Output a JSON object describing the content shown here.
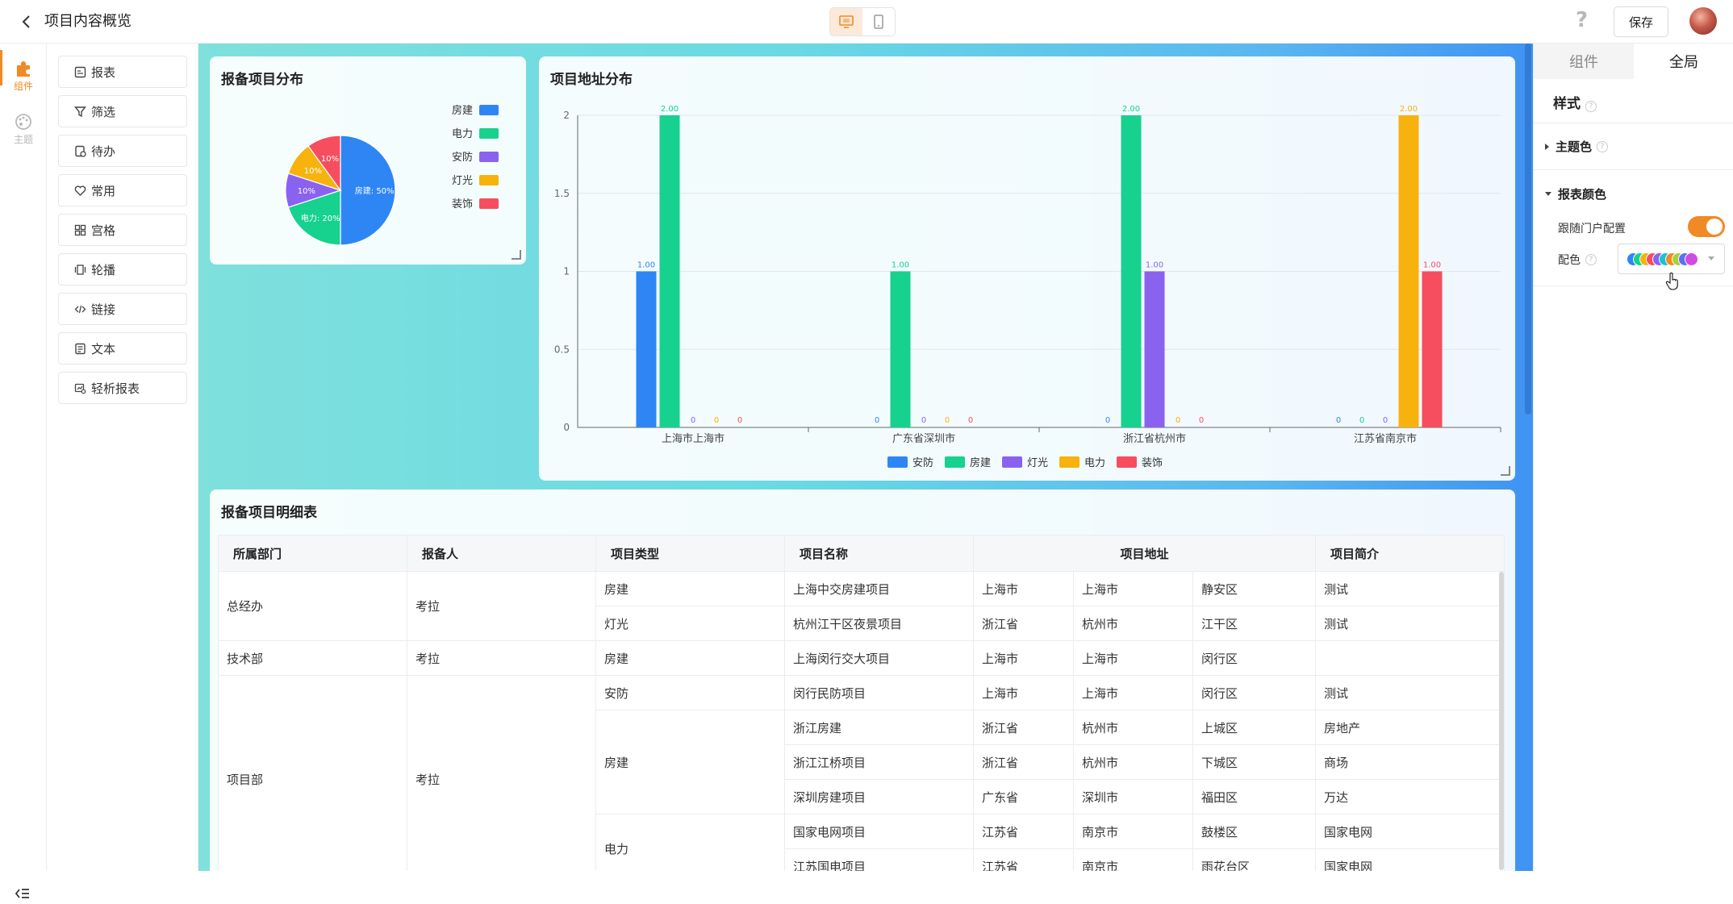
{
  "header": {
    "title": "项目内容概览",
    "save_label": "保存",
    "help_label": "?"
  },
  "rail": {
    "items": [
      {
        "label": "组件",
        "icon": "puzzle-icon",
        "active": true
      },
      {
        "label": "主题",
        "icon": "palette-icon",
        "active": false
      }
    ]
  },
  "components": {
    "items": [
      {
        "label": "报表",
        "icon": "report-icon"
      },
      {
        "label": "筛选",
        "icon": "filter-icon"
      },
      {
        "label": "待办",
        "icon": "todo-icon"
      },
      {
        "label": "常用",
        "icon": "heart-icon"
      },
      {
        "label": "宫格",
        "icon": "grid-icon"
      },
      {
        "label": "轮播",
        "icon": "carousel-icon"
      },
      {
        "label": "链接",
        "icon": "code-link-icon"
      },
      {
        "label": "文本",
        "icon": "text-icon"
      },
      {
        "label": "轻析报表",
        "icon": "analysis-report-icon"
      }
    ]
  },
  "pie_card": {
    "title": "报备项目分布"
  },
  "bar_card": {
    "title": "项目地址分布"
  },
  "chart_data": [
    {
      "type": "pie",
      "title": "报备项目分布",
      "categories": [
        "房建",
        "电力",
        "安防",
        "灯光",
        "装饰"
      ],
      "values": [
        50,
        20,
        10,
        10,
        10
      ],
      "labels": [
        "房建: 50%",
        "电力: 20%",
        "10%",
        "10%",
        "10%"
      ],
      "colors": [
        "#2e86f5",
        "#17d18f",
        "#8a62f0",
        "#f7b20d",
        "#f64e5e"
      ],
      "legend": "right"
    },
    {
      "type": "bar",
      "title": "项目地址分布",
      "categories": [
        "上海市上海市",
        "广东省深圳市",
        "浙江省杭州市",
        "江苏省南京市"
      ],
      "series": [
        {
          "name": "安防",
          "color": "#2e86f5",
          "values": [
            1,
            0,
            0,
            0
          ],
          "labels": [
            "1.00",
            "0",
            "0",
            "0"
          ]
        },
        {
          "name": "房建",
          "color": "#17d18f",
          "values": [
            2,
            1,
            2,
            0
          ],
          "labels": [
            "2.00",
            "1.00",
            "2.00",
            "0"
          ]
        },
        {
          "name": "灯光",
          "color": "#8a62f0",
          "values": [
            0,
            0,
            1,
            0
          ],
          "labels": [
            "0",
            "0",
            "1.00",
            "0"
          ]
        },
        {
          "name": "电力",
          "color": "#f7b20d",
          "values": [
            0,
            0,
            0,
            2
          ],
          "labels": [
            "0",
            "0",
            "0",
            "2.00"
          ]
        },
        {
          "name": "装饰",
          "color": "#f64e5e",
          "values": [
            0,
            0,
            0,
            1
          ],
          "labels": [
            "0",
            "0",
            "0",
            "1.00"
          ]
        }
      ],
      "yticks": [
        "0",
        "0.5",
        "1",
        "1.5",
        "2"
      ],
      "ylim": [
        0,
        2
      ],
      "grid": true,
      "legend": "bottom"
    }
  ],
  "table_card": {
    "title": "报备项目明细表",
    "headers": [
      "所属部门",
      "报备人",
      "项目类型",
      "项目名称",
      "项目地址",
      "项目简介"
    ],
    "groups": [
      {
        "dept": "总经办",
        "person": "考拉",
        "rows": [
          {
            "type": "房建",
            "type_span": 1,
            "name": "上海中交房建项目",
            "province": "上海市",
            "city": "上海市",
            "district": "静安区",
            "intro": "测试"
          },
          {
            "type": "灯光",
            "type_span": 1,
            "name": "杭州江干区夜景项目",
            "province": "浙江省",
            "city": "杭州市",
            "district": "江干区",
            "intro": "测试"
          }
        ]
      },
      {
        "dept": "技术部",
        "person": "考拉",
        "rows": [
          {
            "type": "房建",
            "type_span": 1,
            "name": "上海闵行交大项目",
            "province": "上海市",
            "city": "上海市",
            "district": "闵行区",
            "intro": ""
          }
        ]
      },
      {
        "dept": "项目部",
        "person": "考拉",
        "rows": [
          {
            "type": "安防",
            "type_span": 1,
            "name": "闵行民防项目",
            "province": "上海市",
            "city": "上海市",
            "district": "闵行区",
            "intro": "测试"
          },
          {
            "type": "房建",
            "type_span": 3,
            "name": "浙江房建",
            "province": "浙江省",
            "city": "杭州市",
            "district": "上城区",
            "intro": "房地产"
          },
          {
            "type": null,
            "name": "浙江江桥项目",
            "province": "浙江省",
            "city": "杭州市",
            "district": "下城区",
            "intro": "商场"
          },
          {
            "type": null,
            "name": "深圳房建项目",
            "province": "广东省",
            "city": "深圳市",
            "district": "福田区",
            "intro": "万达"
          },
          {
            "type": "电力",
            "type_span": 2,
            "name": "国家电网项目",
            "province": "江苏省",
            "city": "南京市",
            "district": "鼓楼区",
            "intro": "国家电网"
          },
          {
            "type": null,
            "name": "江苏国电项目",
            "province": "江苏省",
            "city": "南京市",
            "district": "雨花台区",
            "intro": "国家电网"
          }
        ]
      }
    ]
  },
  "right_panel": {
    "tabs": [
      {
        "label": "组件",
        "active": false
      },
      {
        "label": "全局",
        "active": true
      }
    ],
    "section_title": "样式",
    "theme_color_label": "主题色",
    "chart_color_label": "报表颜色",
    "follow_portal_label": "跟随门户配置",
    "follow_portal_on": true,
    "palette_label": "配色",
    "palette_colors": [
      "#2e86f5",
      "#17d18f",
      "#f7b20d",
      "#f64e5e",
      "#8a62f0",
      "#17c3d1",
      "#f08a24",
      "#a9d13a",
      "#5b6ef5",
      "#d14be0"
    ]
  }
}
